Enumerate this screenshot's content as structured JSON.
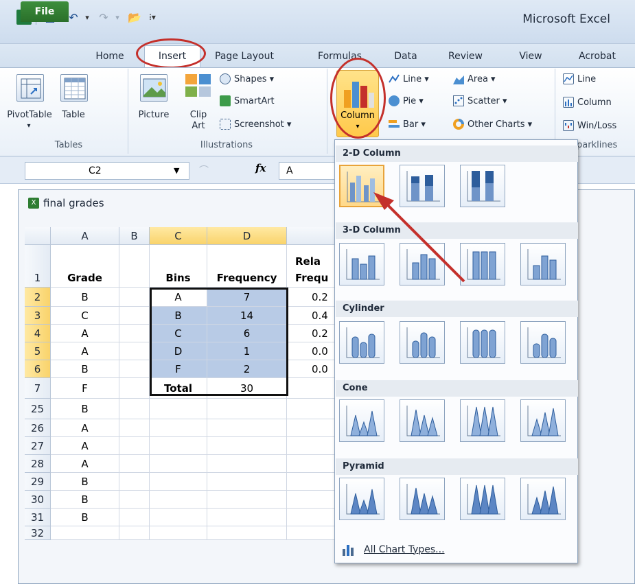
{
  "app": {
    "title": "Microsoft Excel"
  },
  "tabs": [
    {
      "label": "File"
    },
    {
      "label": "Home"
    },
    {
      "label": "Insert"
    },
    {
      "label": "Page Layout"
    },
    {
      "label": "Formulas"
    },
    {
      "label": "Data"
    },
    {
      "label": "Review"
    },
    {
      "label": "View"
    },
    {
      "label": "Acrobat"
    }
  ],
  "ribbon": {
    "tables": {
      "pivottable": "PivotTable",
      "table": "Table",
      "group": "Tables"
    },
    "illustrations": {
      "picture": "Picture",
      "clip_art_1": "Clip",
      "clip_art_2": "Art",
      "shapes": "Shapes ▾",
      "smartart": "SmartArt",
      "screenshot": "Screenshot ▾",
      "group": "Illustrations"
    },
    "charts": {
      "column": "Column",
      "line": "Line ▾",
      "pie": "Pie ▾",
      "bar": "Bar ▾",
      "area": "Area ▾",
      "scatter": "Scatter ▾",
      "other": "Other Charts ▾"
    },
    "sparklines": {
      "line": "Line",
      "column": "Column",
      "winloss": "Win/Loss",
      "group": "parklines"
    }
  },
  "formula_bar": {
    "cell_ref": "C2",
    "fx": "fx",
    "value": "A"
  },
  "workbook": {
    "title": "final grades"
  },
  "sheet": {
    "columns": [
      "A",
      "B",
      "C",
      "D",
      ""
    ],
    "col_e_partial": "",
    "rows": [
      {
        "num": "1",
        "a": "Grade",
        "b": "",
        "c": "Bins",
        "d": "Frequency",
        "e1": "Rela",
        "e2": "Frequ"
      },
      {
        "num": "2",
        "a": "B",
        "b": "",
        "c": "A",
        "d": "7",
        "e": "0.2"
      },
      {
        "num": "3",
        "a": "C",
        "b": "",
        "c": "B",
        "d": "14",
        "e": "0.4"
      },
      {
        "num": "4",
        "a": "A",
        "b": "",
        "c": "C",
        "d": "6",
        "e": "0.2"
      },
      {
        "num": "5",
        "a": "A",
        "b": "",
        "c": "D",
        "d": "1",
        "e": "0.0"
      },
      {
        "num": "6",
        "a": "B",
        "b": "",
        "c": "F",
        "d": "2",
        "e": "0.0"
      },
      {
        "num": "7",
        "a": "F",
        "b": "",
        "c": "Total",
        "d": "30",
        "e": ""
      },
      {
        "num": "25",
        "a": "B",
        "b": "",
        "c": "",
        "d": "",
        "e": ""
      },
      {
        "num": "26",
        "a": "A",
        "b": "",
        "c": "",
        "d": "",
        "e": ""
      },
      {
        "num": "27",
        "a": "A",
        "b": "",
        "c": "",
        "d": "",
        "e": ""
      },
      {
        "num": "28",
        "a": "A",
        "b": "",
        "c": "",
        "d": "",
        "e": ""
      },
      {
        "num": "29",
        "a": "B",
        "b": "",
        "c": "",
        "d": "",
        "e": ""
      },
      {
        "num": "30",
        "a": "B",
        "b": "",
        "c": "",
        "d": "",
        "e": ""
      },
      {
        "num": "31",
        "a": "B",
        "b": "",
        "c": "",
        "d": "",
        "e": ""
      },
      {
        "num": "32",
        "a": "",
        "b": "",
        "c": "",
        "d": "",
        "e": ""
      }
    ]
  },
  "dropdown": {
    "sections": [
      "2-D Column",
      "3-D Column",
      "Cylinder",
      "Cone",
      "Pyramid"
    ],
    "all_chart_types": "All Chart Types..."
  },
  "colors": {
    "accent_red": "#c4302b",
    "selection_fill": "#b8cbe6",
    "file_tab": "#2a6f2a",
    "header_selected": "#f9d36b"
  }
}
